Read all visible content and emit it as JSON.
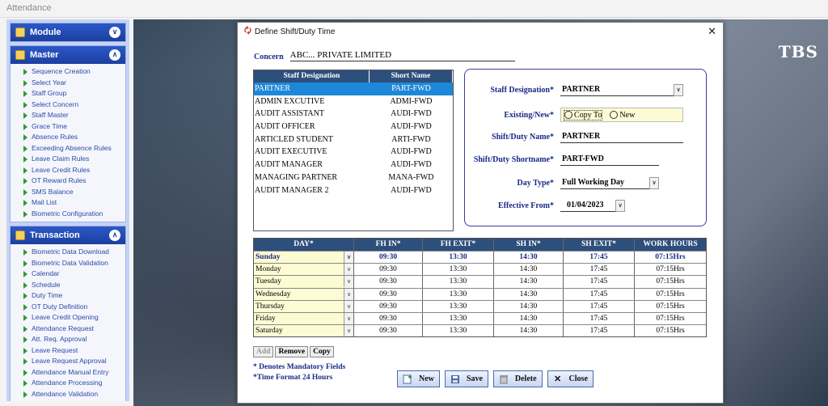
{
  "app": {
    "title": "Attendance"
  },
  "sidebar": {
    "module_label": "Module",
    "master": {
      "label": "Master",
      "items": [
        "Sequence Creation",
        "Select Year",
        "Staff Group",
        "Select Concern",
        "Staff Master",
        "Grace Time",
        "Absence Rules",
        "Exceeding Absence Rules",
        "Leave Claim Rules",
        "Leave Credit Rules",
        "OT Reward Rules",
        "SMS Balance",
        "Mail List",
        "Biometric Configuration"
      ]
    },
    "transaction": {
      "label": "Transaction",
      "items": [
        "Biometric Data Download",
        "Biometric Data Validation",
        "Calendar",
        "Schedule",
        "Duty Time",
        "OT Duty Definition",
        "Leave Credit Opening",
        "Attendance Request",
        "Att. Req. Approval",
        "Leave Request",
        "Leave Request Approval",
        "Attendance Manual Entry",
        "Attendance Processing",
        "Attendance Validation"
      ]
    }
  },
  "background": {
    "logo_text": "TBS"
  },
  "dialog": {
    "title": "Define Shift/Duty Time",
    "concern_label": "Concern",
    "concern_value": "ABC... PRIVATE LIMITED",
    "staff_list": {
      "headers": [
        "Staff Designation",
        "Short Name"
      ],
      "rows": [
        [
          "PARTNER",
          "PART-FWD"
        ],
        [
          "ADMIN EXCUTIVE",
          "ADMI-FWD"
        ],
        [
          "AUDIT ASSISTANT",
          "AUDI-FWD"
        ],
        [
          "AUDIT OFFICER",
          "AUDI-FWD"
        ],
        [
          "ARTICLED STUDENT",
          "ARTI-FWD"
        ],
        [
          "AUDIT EXECUTIVE",
          "AUDI-FWD"
        ],
        [
          "AUDIT MANAGER",
          "AUDI-FWD"
        ],
        [
          "MANAGING PARTNER",
          "MANA-FWD"
        ],
        [
          "AUDIT MANAGER 2",
          "AUDI-FWD"
        ]
      ],
      "selected_index": 0
    },
    "form": {
      "staff_designation_label": "Staff Designation*",
      "staff_designation_value": "PARTNER",
      "existing_new_label": "Existing/New*",
      "copy_to_label": "Copy To",
      "new_label": "New",
      "shift_name_label": "Shift/Duty Name*",
      "shift_name_value": "PARTNER",
      "shift_short_label": "Shift/Duty Shortname*",
      "shift_short_value": "PART-FWD",
      "day_type_label": "Day Type*",
      "day_type_value": "Full Working Day",
      "effective_from_label": "Effective From*",
      "effective_from_value": "01/04/2023"
    },
    "day_grid": {
      "headers": [
        "DAY*",
        "FH IN*",
        "FH EXIT*",
        "SH IN*",
        "SH EXIT*",
        "WORK HOURS"
      ],
      "rows": [
        [
          "Sunday",
          "09:30",
          "13:30",
          "14:30",
          "17:45",
          "07:15Hrs"
        ],
        [
          "Monday",
          "09:30",
          "13:30",
          "14:30",
          "17:45",
          "07:15Hrs"
        ],
        [
          "Tuesday",
          "09:30",
          "13:30",
          "14:30",
          "17:45",
          "07:15Hrs"
        ],
        [
          "Wednesday",
          "09:30",
          "13:30",
          "14:30",
          "17:45",
          "07:15Hrs"
        ],
        [
          "Thursday",
          "09:30",
          "13:30",
          "14:30",
          "17:45",
          "07:15Hrs"
        ],
        [
          "Friday",
          "09:30",
          "13:30",
          "14:30",
          "17:45",
          "07:15Hrs"
        ],
        [
          "Saturday",
          "09:30",
          "13:30",
          "14:30",
          "17:45",
          "07:15Hrs"
        ]
      ]
    },
    "grid_buttons": {
      "add": "Add",
      "remove": "Remove",
      "copy": "Copy"
    },
    "notes": [
      "* Denotes Mandatory Fields",
      "*Time Format 24 Hours"
    ],
    "buttons": {
      "new": "New",
      "save": "Save",
      "delete": "Delete",
      "close": "Close"
    }
  }
}
